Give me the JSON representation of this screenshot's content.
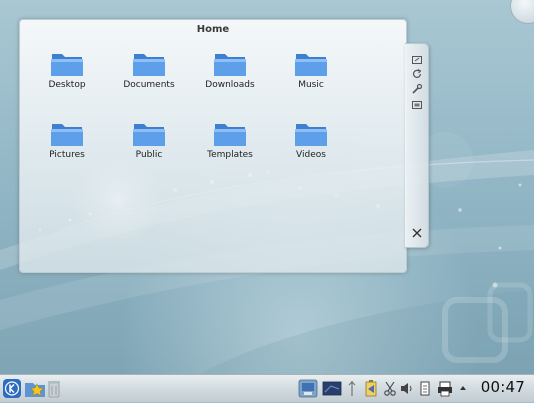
{
  "folderview": {
    "title": "Home",
    "items": [
      {
        "label": "Desktop"
      },
      {
        "label": "Documents"
      },
      {
        "label": "Downloads"
      },
      {
        "label": "Music"
      },
      {
        "label": "Pictures"
      },
      {
        "label": "Public"
      },
      {
        "label": "Templates"
      },
      {
        "label": "Videos"
      }
    ]
  },
  "applet_handle": {
    "buttons": [
      "resize-icon",
      "rotate-icon",
      "configure-icon",
      "move-icon"
    ],
    "close": "close-icon"
  },
  "panel": {
    "clock": "00:47",
    "launcher": "kde-kickoff-icon",
    "tray": [
      "network-icon",
      "monitor-icon",
      "usb-icon",
      "battery-icon",
      "klipper-icon",
      "volume-icon",
      "clipboard-icon",
      "printer-icon",
      "expand-arrow-icon"
    ]
  },
  "colors": {
    "folder_blue": "#5a9be6",
    "desktop_bg": "#9bbdcb",
    "panel_bg": "#d4dde1"
  }
}
